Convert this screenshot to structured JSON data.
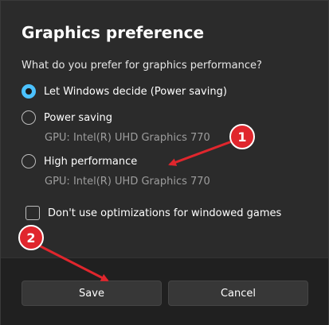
{
  "dialog": {
    "title": "Graphics preference",
    "prompt": "What do you prefer for graphics performance?"
  },
  "options": [
    {
      "label": "Let Windows decide (Power saving)",
      "selected": true,
      "gpu": ""
    },
    {
      "label": "Power saving",
      "selected": false,
      "gpu": "GPU: Intel(R) UHD Graphics 770"
    },
    {
      "label": "High performance",
      "selected": false,
      "gpu": "GPU: Intel(R) UHD Graphics 770"
    }
  ],
  "checkbox": {
    "label": "Don't use optimizations for windowed games",
    "checked": false
  },
  "footer": {
    "save_label": "Save",
    "cancel_label": "Cancel"
  },
  "annotations": [
    {
      "number": "1"
    },
    {
      "number": "2"
    }
  ],
  "colors": {
    "accent": "#4cc2ff",
    "annotation": "#e0262d"
  }
}
